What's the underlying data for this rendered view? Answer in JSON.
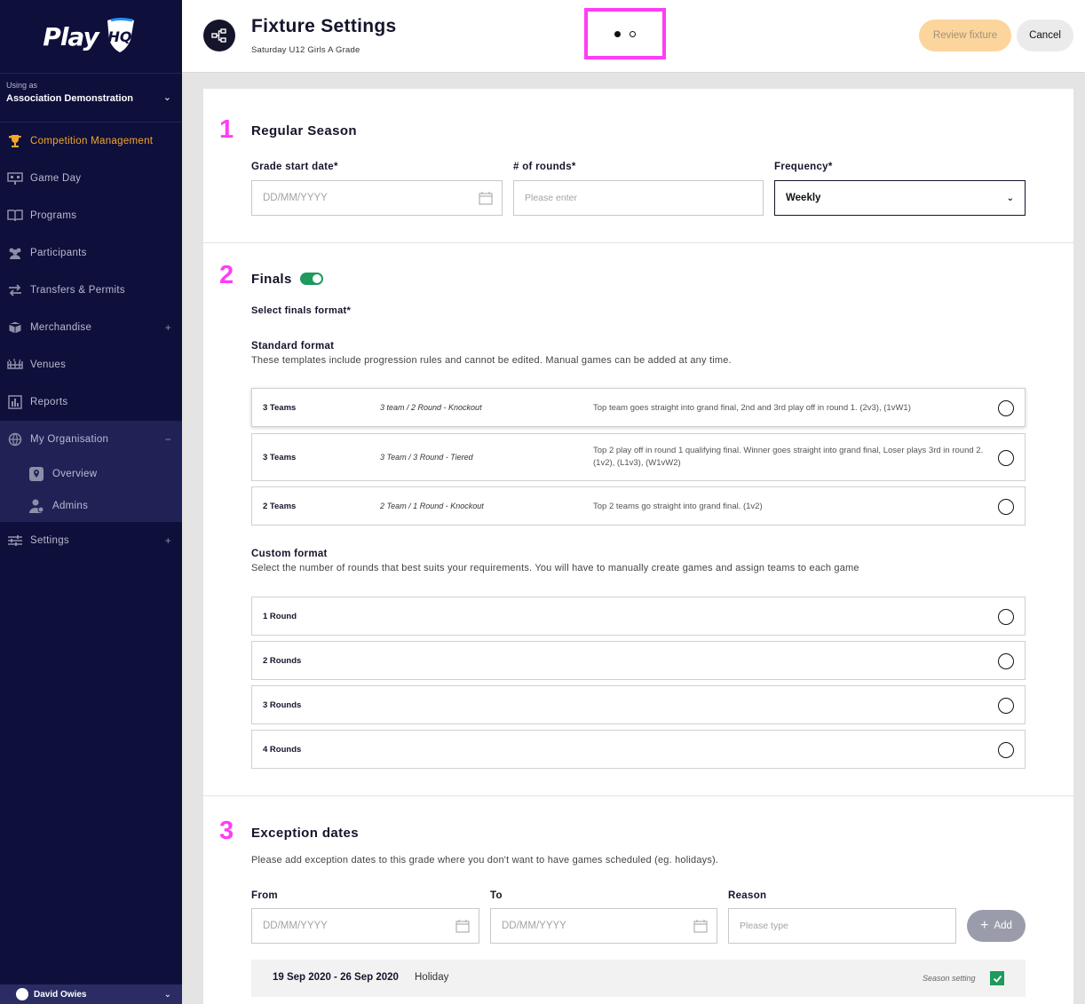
{
  "sidebar": {
    "logo_text": "Play",
    "logo_badge": "HQ",
    "org_using_label": "Using as",
    "org_name": "Association Demonstration",
    "nav": [
      {
        "label": "Competition Management",
        "icon": "trophy-icon",
        "active": true
      },
      {
        "label": "Game Day",
        "icon": "scoreboard-icon"
      },
      {
        "label": "Programs",
        "icon": "book-icon"
      },
      {
        "label": "Participants",
        "icon": "people-icon"
      },
      {
        "label": "Transfers & Permits",
        "icon": "arrows-icon"
      },
      {
        "label": "Merchandise",
        "icon": "box-icon"
      },
      {
        "label": "Venues",
        "icon": "stadium-icon"
      },
      {
        "label": "Reports",
        "icon": "chart-icon"
      },
      {
        "label": "My Organisation",
        "icon": "globe-icon"
      },
      {
        "label": "Settings",
        "icon": "sliders-icon"
      }
    ],
    "sub_nav": [
      {
        "label": "Overview",
        "icon": "location-pin-icon"
      },
      {
        "label": "Admins",
        "icon": "admin-user-icon"
      }
    ],
    "user_name": "David Owies"
  },
  "header": {
    "title": "Fixture Settings",
    "subtitle": "Saturday U12 Girls A Grade",
    "review_label": "Review fixture",
    "cancel_label": "Cancel"
  },
  "regular_season": {
    "number": "1",
    "title": "Regular Season",
    "start_date_label": "Grade start date*",
    "start_date_placeholder": "DD/MM/YYYY",
    "rounds_label": "# of rounds*",
    "rounds_placeholder": "Please enter",
    "frequency_label": "Frequency*",
    "frequency_value": "Weekly"
  },
  "finals": {
    "number": "2",
    "title": "Finals",
    "toggle_on": true,
    "select_label": "Select finals format*",
    "standard_title": "Standard format",
    "standard_desc": "These templates include progression rules and cannot be edited. Manual games can be added at any time.",
    "standard_options": [
      {
        "teams": "3 Teams",
        "format": "3 team / 2 Round - Knockout",
        "description": "Top team goes straight into grand final, 2nd and 3rd play off in round 1. (2v3), (1vW1)"
      },
      {
        "teams": "3 Teams",
        "format": "3 Team / 3 Round - Tiered",
        "description": "Top 2 play off in round 1 qualifying final. Winner goes straight into grand final, Loser plays 3rd in round 2. (1v2), (L1v3), (W1vW2)"
      },
      {
        "teams": "2 Teams",
        "format": "2 Team / 1 Round - Knockout",
        "description": "Top 2 teams go straight into grand final. (1v2)"
      }
    ],
    "custom_title": "Custom format",
    "custom_desc": "Select the number of rounds that best suits your requirements. You will have to manually create games and assign teams to each game",
    "custom_options": [
      "1 Round",
      "2 Rounds",
      "3 Rounds",
      "4 Rounds"
    ]
  },
  "exceptions": {
    "number": "3",
    "title": "Exception dates",
    "desc": "Please add exception dates to this grade where you don't want to have games scheduled (eg. holidays).",
    "from_label": "From",
    "from_placeholder": "DD/MM/YYYY",
    "to_label": "To",
    "to_placeholder": "DD/MM/YYYY",
    "reason_label": "Reason",
    "reason_placeholder": "Please type",
    "add_label": "Add",
    "rows": [
      {
        "dates": "19 Sep 2020 - 26 Sep 2020",
        "reason": "Holiday",
        "setting": "Season setting",
        "checked": true
      }
    ]
  },
  "colors": {
    "sidebar_bg": "#0e0f3b",
    "accent_orange": "#f4a62a",
    "highlight_pink": "#ff3df5",
    "toggle_green": "#1d9a5c"
  }
}
